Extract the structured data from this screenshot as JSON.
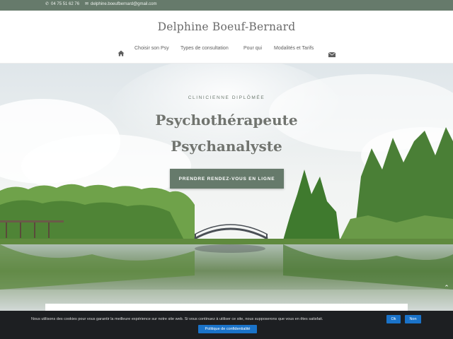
{
  "topbar": {
    "phone": "04 75 51 62 76",
    "email": "delphine.boeufbernard@gmail.com",
    "phone_icon": "phone-icon",
    "email_icon": "envelope-icon",
    "bg_color": "#667a6b"
  },
  "header": {
    "site_title": "Delphine Boeuf-Bernard"
  },
  "nav": {
    "home_icon": "home-icon",
    "items": [
      {
        "label": "Choisir son Psy"
      },
      {
        "label": "Types de consultation"
      },
      {
        "label": "Pour qui"
      },
      {
        "label": "Modalités et Tarifs"
      }
    ],
    "contact_icon": "envelope-icon"
  },
  "hero": {
    "eyebrow": "CLINICIENNE DIPLÔMÉE",
    "title_line1": "Psychothérapeute",
    "title_line2": "Psychanalyste",
    "cta_label": "PRENDRE RENDEZ-VOUS EN LIGNE",
    "accent_color": "#667a6b"
  },
  "cookie": {
    "text": "Nous utilisons des cookies pour vous garantir la meilleure expérience sur notre site web. Si vous continuez à utiliser ce site, nous supposerons que vous en êtes satisfait.",
    "ok_label": "Ok",
    "no_label": "Non",
    "policy_label": "Politique de confidentialité",
    "button_color": "#1a73c9"
  }
}
